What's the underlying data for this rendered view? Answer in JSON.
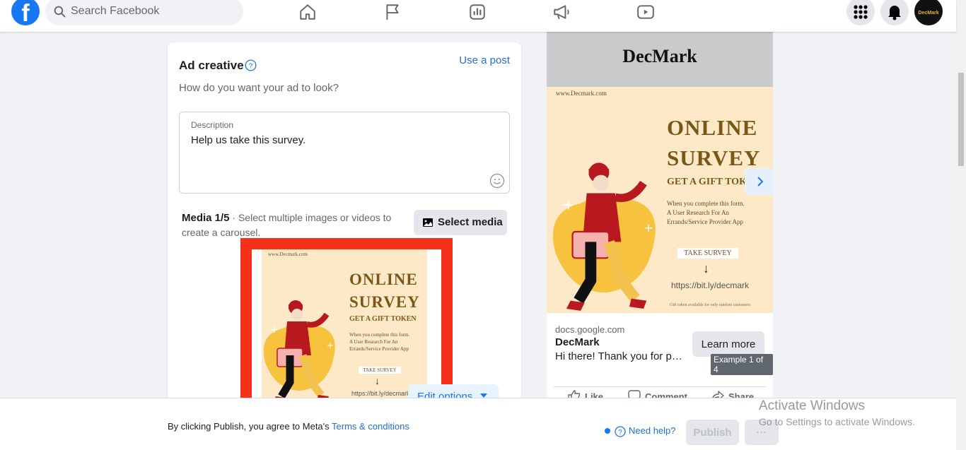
{
  "topbar": {
    "logo": "f",
    "search_placeholder": "Search Facebook",
    "nav_icons": [
      "home-icon",
      "flag-icon",
      "chart-icon",
      "megaphone-icon",
      "video-icon"
    ],
    "right_icons": [
      "menu-grid-icon",
      "bell-icon"
    ],
    "avatar_text": "DecMark"
  },
  "ad_creative": {
    "title": "Ad creative",
    "use_post": "Use a post",
    "subtitle": "How do you want your ad to look?",
    "description_label": "Description",
    "description_value": "Help us take this survey.",
    "media_title": "Media 1/5",
    "media_hint": " · Select multiple images or videos to create a carousel.",
    "select_media": "Select media",
    "edit_options": "Edit options"
  },
  "poster": {
    "url": "www.Decmark.com",
    "line1": "ONLINE",
    "line2": "SURVEY",
    "gift": "GET A GIFT TOKEN",
    "body1": "When you complete this form.",
    "body2": "A User Research For An",
    "body3": "Errands/Service Provider App",
    "take_survey": "TAKE SURVEY",
    "arrow": "↓",
    "link": "https://bit.ly/decmark",
    "fine": "Gift token available for only random customers"
  },
  "preview": {
    "brand": "DecMark",
    "domain": "docs.google.com",
    "name": "DecMark",
    "text": "Hi there! Thank you for participating",
    "learn_more": "Learn more",
    "example": "Example 1 of 4",
    "actions": {
      "like": "Like",
      "comment": "Comment",
      "share": "Share"
    }
  },
  "footer": {
    "agree_prefix": "By clicking Publish, you agree to Meta's ",
    "terms": "Terms & conditions",
    "need_help": "Need help?",
    "publish": "Publish",
    "more": "···"
  },
  "watermark": {
    "line1": "Activate Windows",
    "line2": "Go to Settings to activate Windows."
  },
  "colors": {
    "brand_blue": "#1877f2",
    "highlight_red": "#f5311b",
    "poster_bg": "#fde9c8",
    "poster_text": "#7a5716"
  }
}
